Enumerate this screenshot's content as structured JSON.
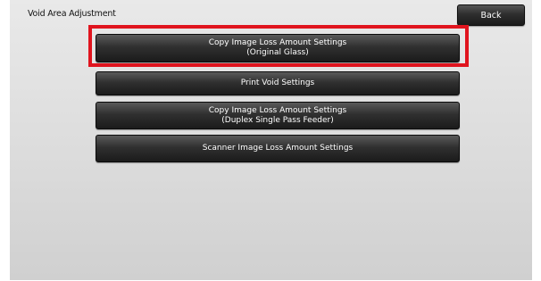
{
  "header": {
    "title": "Void Area Adjustment",
    "back_label": "Back"
  },
  "menu": {
    "items": [
      {
        "line1": "Copy Image Loss Amount Settings",
        "line2": "(Original Glass)"
      },
      {
        "line1": "Print Void Settings",
        "line2": ""
      },
      {
        "line1": "Copy Image Loss Amount Settings",
        "line2": "(Duplex Single Pass Feeder)"
      },
      {
        "line1": "Scanner Image Loss Amount Settings",
        "line2": ""
      }
    ]
  },
  "colors": {
    "highlight": "#e0141e",
    "button": "#2e2e2e",
    "panel": "#dcdcdc"
  }
}
